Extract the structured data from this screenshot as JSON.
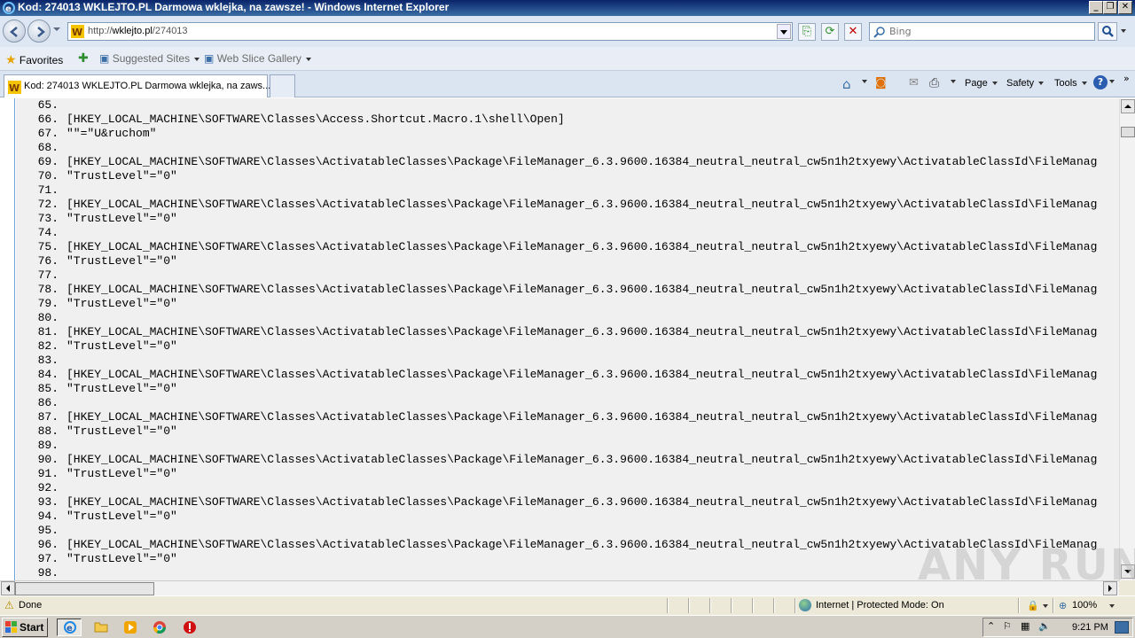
{
  "window": {
    "title": "Kod: 274013 WKLEJTO.PL Darmowa wklejka, na zawsze! - Windows Internet Explorer"
  },
  "address": {
    "url_prefix": "http://",
    "url_host": "wklejto.pl",
    "url_path": "/274013",
    "search_placeholder": "Bing"
  },
  "favorites": {
    "favorites_label": "Favorites",
    "suggested_label": "Suggested Sites",
    "webslice_label": "Web Slice Gallery"
  },
  "tabs": [
    {
      "label": "Kod: 274013 WKLEJTO.PL Darmowa wklejka, na zaws..."
    }
  ],
  "commandbar": {
    "page_label": "Page",
    "safety_label": "Safety",
    "tools_label": "Tools"
  },
  "code_lines": [
    {
      "num": "65.",
      "text": ""
    },
    {
      "num": "66.",
      "text": "[HKEY_LOCAL_MACHINE\\SOFTWARE\\Classes\\Access.Shortcut.Macro.1\\shell\\Open]"
    },
    {
      "num": "67.",
      "text": "\"\"=\"U&ruchom\""
    },
    {
      "num": "68.",
      "text": ""
    },
    {
      "num": "69.",
      "text": "[HKEY_LOCAL_MACHINE\\SOFTWARE\\Classes\\ActivatableClasses\\Package\\FileManager_6.3.9600.16384_neutral_neutral_cw5n1h2txyewy\\ActivatableClassId\\FileManag"
    },
    {
      "num": "70.",
      "text": "\"TrustLevel\"=\"0\""
    },
    {
      "num": "71.",
      "text": ""
    },
    {
      "num": "72.",
      "text": "[HKEY_LOCAL_MACHINE\\SOFTWARE\\Classes\\ActivatableClasses\\Package\\FileManager_6.3.9600.16384_neutral_neutral_cw5n1h2txyewy\\ActivatableClassId\\FileManag"
    },
    {
      "num": "73.",
      "text": "\"TrustLevel\"=\"0\""
    },
    {
      "num": "74.",
      "text": ""
    },
    {
      "num": "75.",
      "text": "[HKEY_LOCAL_MACHINE\\SOFTWARE\\Classes\\ActivatableClasses\\Package\\FileManager_6.3.9600.16384_neutral_neutral_cw5n1h2txyewy\\ActivatableClassId\\FileManag"
    },
    {
      "num": "76.",
      "text": "\"TrustLevel\"=\"0\""
    },
    {
      "num": "77.",
      "text": ""
    },
    {
      "num": "78.",
      "text": "[HKEY_LOCAL_MACHINE\\SOFTWARE\\Classes\\ActivatableClasses\\Package\\FileManager_6.3.9600.16384_neutral_neutral_cw5n1h2txyewy\\ActivatableClassId\\FileManag"
    },
    {
      "num": "79.",
      "text": "\"TrustLevel\"=\"0\""
    },
    {
      "num": "80.",
      "text": ""
    },
    {
      "num": "81.",
      "text": "[HKEY_LOCAL_MACHINE\\SOFTWARE\\Classes\\ActivatableClasses\\Package\\FileManager_6.3.9600.16384_neutral_neutral_cw5n1h2txyewy\\ActivatableClassId\\FileManag"
    },
    {
      "num": "82.",
      "text": "\"TrustLevel\"=\"0\""
    },
    {
      "num": "83.",
      "text": ""
    },
    {
      "num": "84.",
      "text": "[HKEY_LOCAL_MACHINE\\SOFTWARE\\Classes\\ActivatableClasses\\Package\\FileManager_6.3.9600.16384_neutral_neutral_cw5n1h2txyewy\\ActivatableClassId\\FileManag"
    },
    {
      "num": "85.",
      "text": "\"TrustLevel\"=\"0\""
    },
    {
      "num": "86.",
      "text": ""
    },
    {
      "num": "87.",
      "text": "[HKEY_LOCAL_MACHINE\\SOFTWARE\\Classes\\ActivatableClasses\\Package\\FileManager_6.3.9600.16384_neutral_neutral_cw5n1h2txyewy\\ActivatableClassId\\FileManag"
    },
    {
      "num": "88.",
      "text": "\"TrustLevel\"=\"0\""
    },
    {
      "num": "89.",
      "text": ""
    },
    {
      "num": "90.",
      "text": "[HKEY_LOCAL_MACHINE\\SOFTWARE\\Classes\\ActivatableClasses\\Package\\FileManager_6.3.9600.16384_neutral_neutral_cw5n1h2txyewy\\ActivatableClassId\\FileManag"
    },
    {
      "num": "91.",
      "text": "\"TrustLevel\"=\"0\""
    },
    {
      "num": "92.",
      "text": ""
    },
    {
      "num": "93.",
      "text": "[HKEY_LOCAL_MACHINE\\SOFTWARE\\Classes\\ActivatableClasses\\Package\\FileManager_6.3.9600.16384_neutral_neutral_cw5n1h2txyewy\\ActivatableClassId\\FileManag"
    },
    {
      "num": "94.",
      "text": "\"TrustLevel\"=\"0\""
    },
    {
      "num": "95.",
      "text": ""
    },
    {
      "num": "96.",
      "text": "[HKEY_LOCAL_MACHINE\\SOFTWARE\\Classes\\ActivatableClasses\\Package\\FileManager_6.3.9600.16384_neutral_neutral_cw5n1h2txyewy\\ActivatableClassId\\FileManag"
    },
    {
      "num": "97.",
      "text": "\"TrustLevel\"=\"0\""
    },
    {
      "num": "98.",
      "text": ""
    }
  ],
  "statusbar": {
    "status_text": "Done",
    "zone_text": "Internet | Protected Mode: On",
    "zoom_text": "100%"
  },
  "taskbar": {
    "start_label": "Start",
    "clock": "9:21 PM"
  },
  "watermark_text": "ANY RUN",
  "colors": {
    "title_bar": "#0a246a",
    "code_bg": "#f0f0f0",
    "gutter_border": "#6fa6d8"
  }
}
